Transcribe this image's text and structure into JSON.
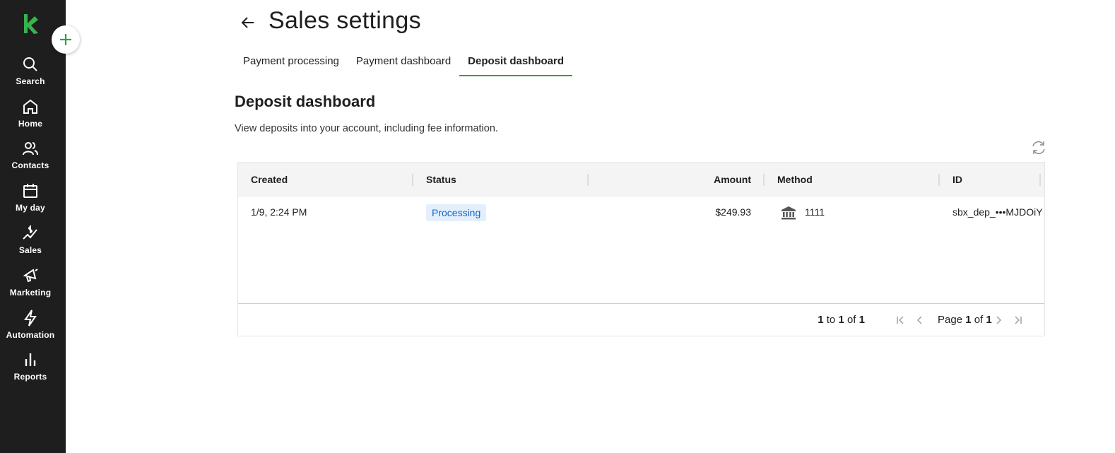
{
  "sidebar": {
    "logo_icon": "keap-logo-icon",
    "items": [
      {
        "label": "Search",
        "icon": "search-icon"
      },
      {
        "label": "Home",
        "icon": "home-icon"
      },
      {
        "label": "Contacts",
        "icon": "contacts-icon"
      },
      {
        "label": "My day",
        "icon": "calendar-icon"
      },
      {
        "label": "Sales",
        "icon": "sales-icon"
      },
      {
        "label": "Marketing",
        "icon": "megaphone-icon"
      },
      {
        "label": "Automation",
        "icon": "lightning-icon"
      },
      {
        "label": "Reports",
        "icon": "bar-chart-icon"
      }
    ],
    "add_icon": "plus-icon"
  },
  "header": {
    "title": "Sales settings",
    "back_icon": "arrow-left-icon"
  },
  "tabs": [
    {
      "label": "Payment processing",
      "active": false
    },
    {
      "label": "Payment dashboard",
      "active": false
    },
    {
      "label": "Deposit dashboard",
      "active": true
    }
  ],
  "section": {
    "title": "Deposit dashboard",
    "description": "View deposits into your account, including fee information.",
    "refresh_icon": "refresh-icon"
  },
  "table": {
    "columns": [
      "Created",
      "Status",
      "Amount",
      "Method",
      "ID"
    ],
    "rows": [
      {
        "created": "1/9, 2:24 PM",
        "status": "Processing",
        "amount": "$249.93",
        "method_icon": "bank-icon",
        "method": "1111",
        "id": "sbx_dep_•••MJDOiY"
      }
    ],
    "footer": {
      "range_start": "1",
      "range_to": "to",
      "range_end": "1",
      "range_of": "of",
      "range_total": "1",
      "page_word": "Page",
      "page_current": "1",
      "page_of": "of",
      "page_total": "1"
    }
  },
  "colors": {
    "sidebar_bg": "#1e1e1e",
    "accent_green": "#27a644",
    "badge_bg": "#e3effc",
    "badge_text": "#1366c7"
  }
}
